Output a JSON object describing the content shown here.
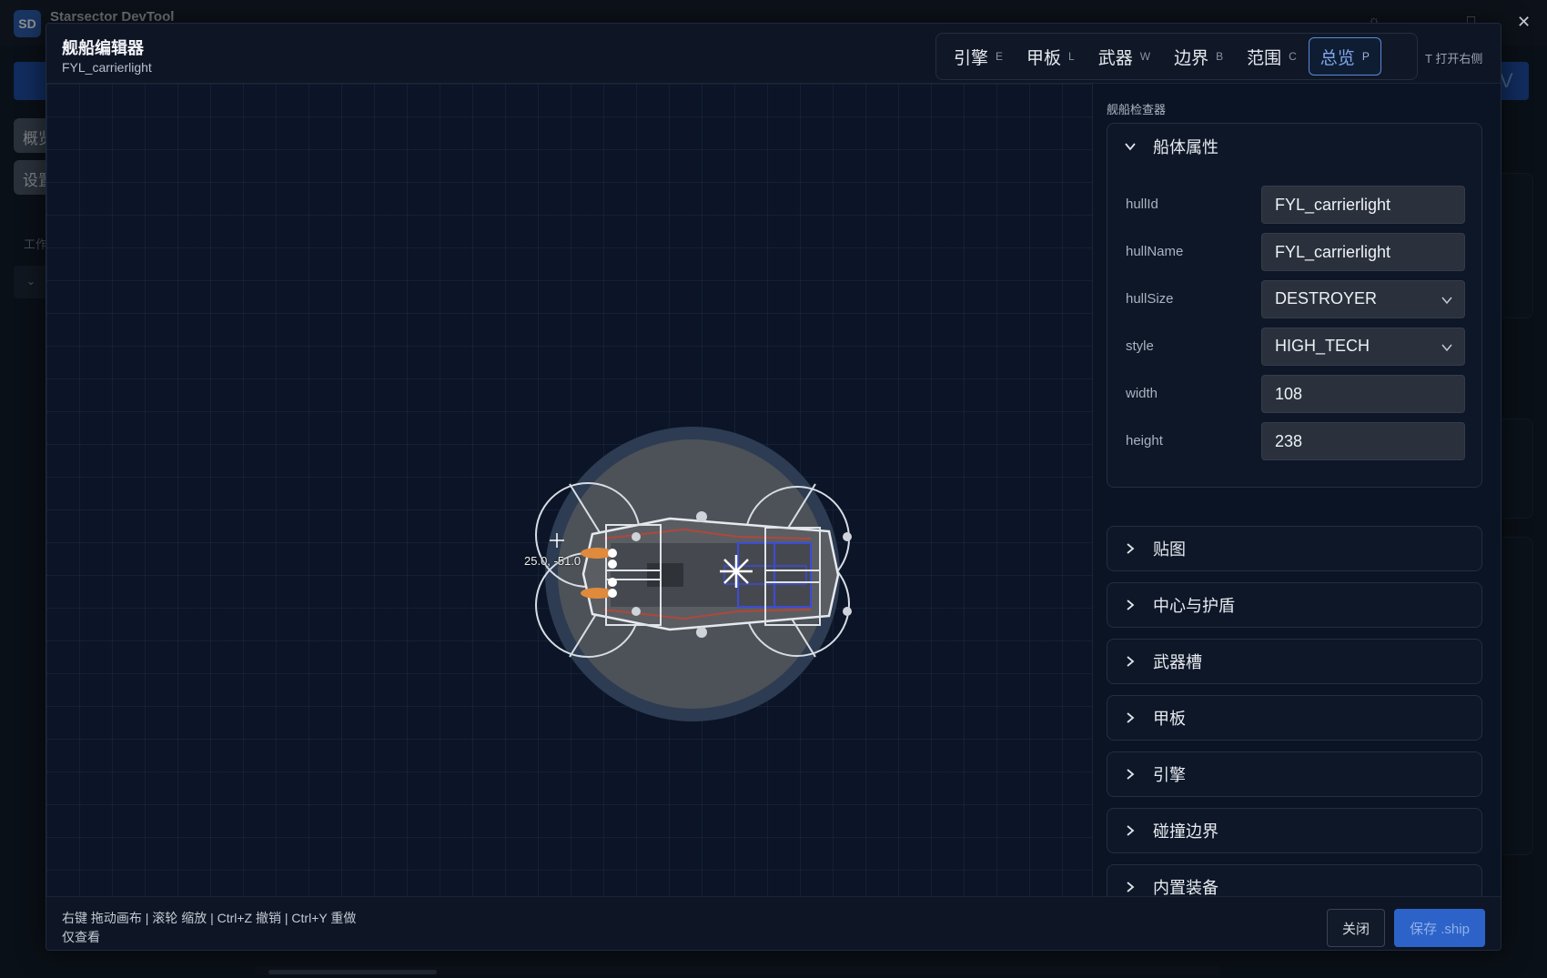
{
  "app": {
    "logo": "SD",
    "name": "Starsector DevTool"
  },
  "background": {
    "side_buttons": [
      "概览",
      "设置"
    ],
    "section_label": "工作",
    "right_button": "V"
  },
  "modal": {
    "title": "舰船编辑器",
    "subtitle": "FYL_carrierlight",
    "modes": [
      {
        "label": "引擎",
        "key": "E",
        "active": false
      },
      {
        "label": "甲板",
        "key": "L",
        "active": false
      },
      {
        "label": "武器",
        "key": "W",
        "active": false
      },
      {
        "label": "边界",
        "key": "B",
        "active": false
      },
      {
        "label": "范围",
        "key": "C",
        "active": false
      },
      {
        "label": "总览",
        "key": "P",
        "active": true
      }
    ],
    "open_right_label": "T 打开右侧"
  },
  "canvas": {
    "cursor_coord": "25.0, -51.0"
  },
  "inspector": {
    "title": "舰船检查器",
    "hull_section": {
      "name": "船体属性",
      "props": [
        {
          "key": "hullId",
          "value": "FYL_carrierlight",
          "type": "input"
        },
        {
          "key": "hullName",
          "value": "FYL_carrierlight",
          "type": "input"
        },
        {
          "key": "hullSize",
          "value": "DESTROYER",
          "type": "select"
        },
        {
          "key": "style",
          "value": "HIGH_TECH",
          "type": "select"
        },
        {
          "key": "width",
          "value": "108",
          "type": "input"
        },
        {
          "key": "height",
          "value": "238",
          "type": "input"
        }
      ]
    },
    "collapsed_sections": [
      "贴图",
      "中心与护盾",
      "武器槽",
      "甲板",
      "引擎",
      "碰撞边界",
      "内置装备"
    ]
  },
  "footer": {
    "hint_line1": "右键 拖动画布 | 滚轮 缩放 | Ctrl+Z 撤销 | Ctrl+Y 重做",
    "hint_line2": "仅查看",
    "close_label": "关闭",
    "save_label": "保存 .ship"
  },
  "colors": {
    "accent": "#5b8ad8",
    "save_button": "#2d63c8",
    "canvas_bg": "#0b1527"
  }
}
